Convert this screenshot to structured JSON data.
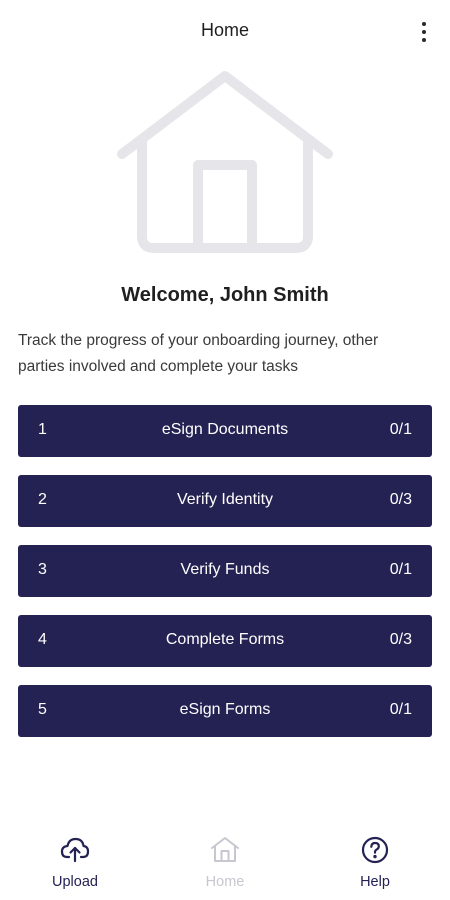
{
  "appbar": {
    "title": "Home",
    "menu_icon": "more-vert-icon"
  },
  "hero": {
    "icon": "house-illustration"
  },
  "welcome": "Welcome, John Smith",
  "subtitle": "Track the progress of your onboarding journey, other parties involved and complete your tasks",
  "tasks": [
    {
      "num": "1",
      "label": "eSign Documents",
      "count": "0/1"
    },
    {
      "num": "2",
      "label": "Verify Identity",
      "count": "0/3"
    },
    {
      "num": "3",
      "label": "Verify Funds",
      "count": "0/1"
    },
    {
      "num": "4",
      "label": "Complete Forms",
      "count": "0/3"
    },
    {
      "num": "5",
      "label": "eSign Forms",
      "count": "0/1"
    }
  ],
  "bottom_nav": {
    "upload": {
      "label": "Upload",
      "icon": "cloud-upload-icon"
    },
    "home": {
      "label": "Home",
      "icon": "home-icon",
      "state": "disabled"
    },
    "help": {
      "label": "Help",
      "icon": "help-circle-icon"
    }
  },
  "colors": {
    "primary": "#242253",
    "disabled": "#c7c7cf",
    "illustration": "#e6e6ea"
  }
}
